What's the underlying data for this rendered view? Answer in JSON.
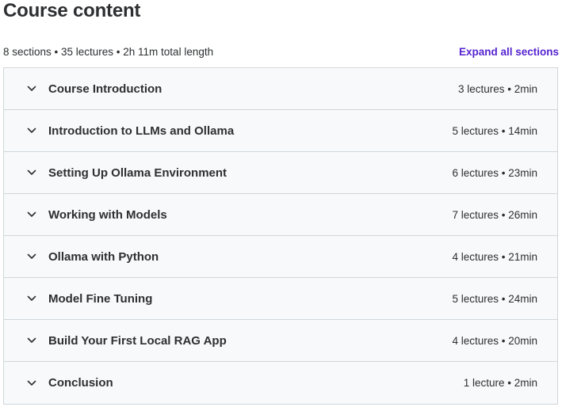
{
  "header": {
    "title": "Course content",
    "summary": "8 sections • 35 lectures • 2h 11m total length",
    "expand_label": "Expand all sections"
  },
  "sections": [
    {
      "title": "Course Introduction",
      "meta": "3 lectures • 2min"
    },
    {
      "title": "Introduction to LLMs and Ollama",
      "meta": "5 lectures • 14min"
    },
    {
      "title": "Setting Up Ollama Environment",
      "meta": "6 lectures • 23min"
    },
    {
      "title": "Working with Models",
      "meta": "7 lectures • 26min"
    },
    {
      "title": "Ollama with Python",
      "meta": "4 lectures • 21min"
    },
    {
      "title": "Model Fine Tuning",
      "meta": "5 lectures • 24min"
    },
    {
      "title": "Build Your First Local RAG App",
      "meta": "4 lectures • 20min"
    },
    {
      "title": "Conclusion",
      "meta": "1 lecture • 2min"
    }
  ],
  "icons": {
    "section_toggle": "chevron-down-icon"
  },
  "colors": {
    "text": "#2d2f31",
    "accent": "#5624d0",
    "section_bg": "#f7f9fa",
    "border": "#d1d7dc"
  }
}
